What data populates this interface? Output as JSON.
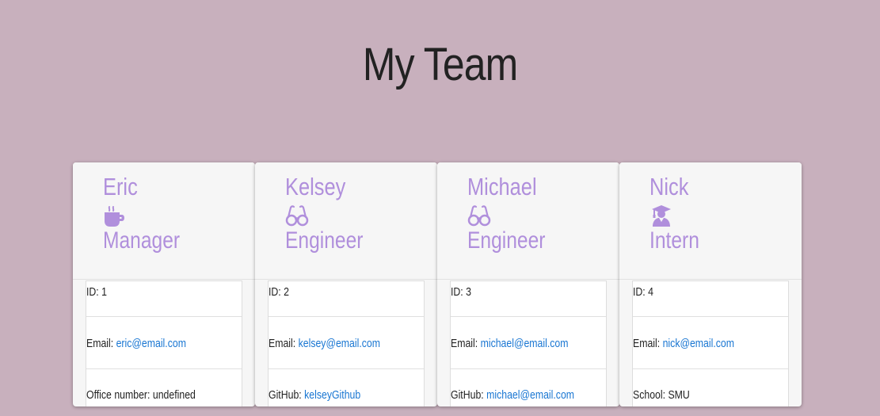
{
  "page": {
    "title": "My Team",
    "background_color": "#c8b0bd",
    "accent_color": "#b08fdc",
    "link_color": "#1976d2"
  },
  "team": [
    {
      "name": "Eric",
      "role": "Manager",
      "icon": "coffee-icon",
      "id_label": "ID: 1",
      "email_label": "Email: ",
      "email": "eric@email.com",
      "extra_label": "Office number: undefined",
      "extra_link": ""
    },
    {
      "name": "Kelsey",
      "role": "Engineer",
      "icon": "glasses-icon",
      "id_label": "ID: 2",
      "email_label": "Email: ",
      "email": "kelsey@email.com",
      "extra_label": "GitHub: ",
      "extra_link": "kelseyGithub"
    },
    {
      "name": "Michael",
      "role": "Engineer",
      "icon": "glasses-icon",
      "id_label": "ID: 3",
      "email_label": "Email: ",
      "email": "michael@email.com",
      "extra_label": "GitHub: ",
      "extra_link": "michael@email.com"
    },
    {
      "name": "Nick",
      "role": "Intern",
      "icon": "graduate-icon",
      "id_label": "ID: 4",
      "email_label": "Email: ",
      "email": "nick@email.com",
      "extra_label": "School: SMU",
      "extra_link": ""
    }
  ]
}
